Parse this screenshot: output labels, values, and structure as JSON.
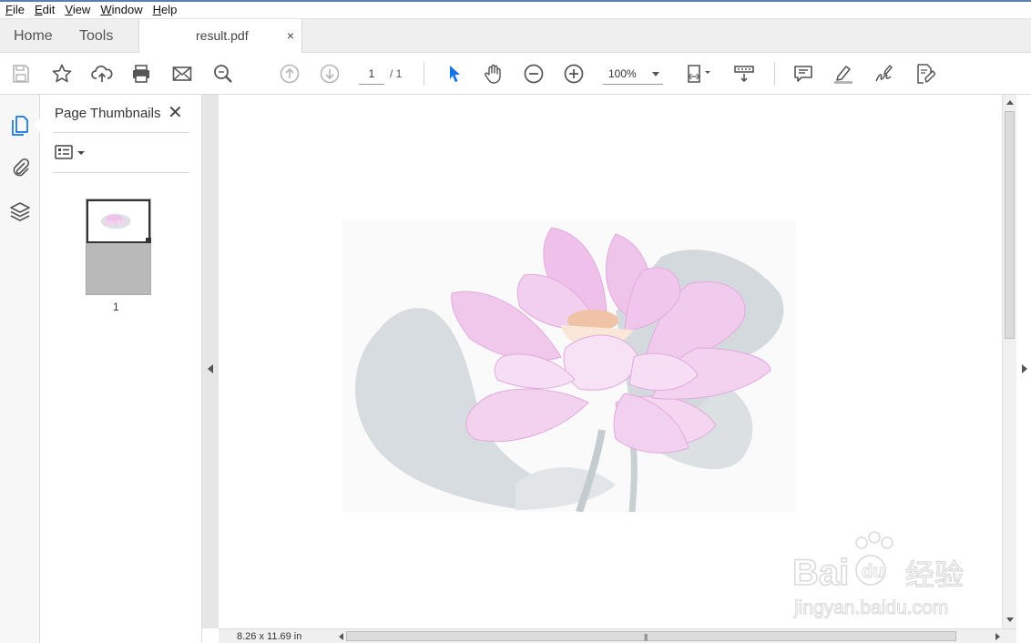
{
  "menu": {
    "items": [
      {
        "key": "F",
        "rest": "ile"
      },
      {
        "key": "E",
        "rest": "dit"
      },
      {
        "key": "V",
        "rest": "iew"
      },
      {
        "key": "W",
        "rest": "indow"
      },
      {
        "key": "H",
        "rest": "elp"
      }
    ]
  },
  "tabs": {
    "home": "Home",
    "tools": "Tools",
    "document": "result.pdf",
    "close_glyph": "×"
  },
  "toolbar": {
    "page_current": "1",
    "page_total": "/ 1",
    "zoom": "100%",
    "icons": [
      "save-icon",
      "bookmark-star-icon",
      "upload-cloud-icon",
      "print-icon",
      "email-icon",
      "find-icon",
      "previous-page-icon",
      "next-page-icon",
      "select-arrow-icon",
      "hand-tool-icon",
      "zoom-out-icon",
      "zoom-in-icon",
      "fit-page-icon",
      "scroll-mode-icon",
      "comment-icon",
      "highlight-icon",
      "sign-icon",
      "fill-sign-icon"
    ]
  },
  "rail": {
    "icons": [
      "page-thumbnails-icon",
      "attachments-icon",
      "layers-icon"
    ]
  },
  "thumbnails_panel": {
    "title": "Page Thumbnails",
    "close_glyph": "✕",
    "page_label": "1"
  },
  "status": {
    "page_size": "8.26 x 11.69 in"
  },
  "watermark": {
    "brand": "Bai  经验",
    "url": "jingyan.baidu.com"
  },
  "colors": {
    "accent_blue": "#1473e6",
    "icon_gray": "#555555",
    "disabled_gray": "#b5b5b5",
    "lotus_pink": "#e8a6e0",
    "leaf_gray": "#c9d0d3"
  }
}
